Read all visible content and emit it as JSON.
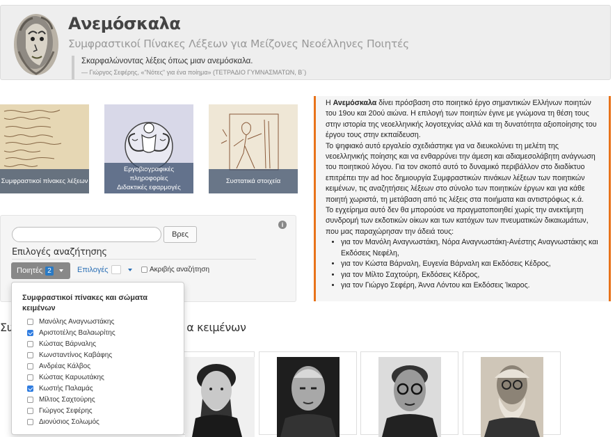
{
  "header": {
    "title": "Ανεμόσκαλα",
    "subtitle": "Συμφραστικοί Πίνακες Λέξεων για Μείζονες Νεοέλληνες Ποιητές",
    "quote_text": "Σκαρφαλώνοντας λέξεις όπως μιαν ανεμόσκαλα.",
    "quote_source": "— Γιώργος Σεφέρης, «\"Νότες\" για ένα ποίημα» (ΤΕΤΡΑΔΙΟ ΓΥΜΝΑΣΜΑΤΩΝ, Β΄)"
  },
  "tiles": [
    {
      "label": "Συμφραστικοί πίνακες λέξεων"
    },
    {
      "label_line1": "Εργοβιογραφικές",
      "label_line2": "πληροφορίες",
      "label_line3": "Διδακτικές εφαρμογές"
    },
    {
      "label": "Συστατικά στοιχεία"
    }
  ],
  "intro": {
    "p1_bold": "Ανεμόσκαλα",
    "p1_rest": " δίνει πρόσβαση στο ποιητικό έργο σημαντικών Ελλήνων ποιητών του 19ου και 20ού αιώνα. Η επιλογή των ποιητών έγινε με γνώμονα τη θέση τους στην ιστορία της νεοελληνικής λογοτεχνίας αλλά και τη δυνατότητα αξιοποίησης του έργου τους στην εκπαίδευση.",
    "p1_prefix": "Η ",
    "p2": "Το ψηφιακό αυτό εργαλείο σχεδιάστηκε για να διευκολύνει τη μελέτη της νεοελληνικής ποίησης και να ενθαρρύνει την άμεση και αδιαμεσολάβητη ανάγνωση του ποιητικού λόγου. Για τον σκοπό αυτό το δυναμικό περιβάλλον στο διαδίκτυο επιτρέπει την ad hoc δημιουργία Συμφραστικών πινάκων λέξεων των ποιητικών κειμένων, τις αναζητήσεις λέξεων στο σύνολο των ποιητικών έργων και για κάθε ποιητή χωριστά, τη μετάβαση από τις λέξεις στα ποιήματα και αντιστρόφως κ.ά.",
    "p3": "Το εγχείρημα αυτό δεν θα μπορούσε να πραγματοποιηθεί χωρίς την ανεκτίμητη συνδρομή των εκδοτικών οίκων και των κατόχων των πνευματικών δικαιωμάτων, που μας παραχώρησαν την άδειά τους:",
    "permissions": [
      "για τον Μανόλη Αναγνωστάκη, Νόρα Αναγνωστάκη-Ανέστης Αναγνωστάκης και Εκδόσεις Νεφέλη,",
      "για τον Κώστα Βάρναλη, Ευγενία Βάρναλη και Εκδόσεις Κέδρος,",
      "για τον Μίλτο Σαχτούρη, Εκδόσεις Κέδρος,",
      "για τον Γιώργο Σεφέρη, Άννα Λόντου και Εκδόσεις Ίκαρος."
    ]
  },
  "search": {
    "input_value": "",
    "button_label": "Βρες",
    "info_icon": "i",
    "options_title": "Επιλογές αναζήτησης",
    "poets_label": "Ποιητές",
    "poets_count": "2",
    "options_label": "Επιλογές",
    "exact_label": "Ακριβής αναζήτηση"
  },
  "section": {
    "heading_visible_start": "Συ",
    "heading_visible_end": "α κειμένων"
  },
  "dropdown": {
    "header": "Συμφραστικοί πίνακες και σώματα κειμένων",
    "items": [
      {
        "label": "Μανόλης Αναγνωστάκης",
        "checked": false
      },
      {
        "label": "Αριστοτέλης Βαλαωρίτης",
        "checked": true
      },
      {
        "label": "Κώστας Βάρναλης",
        "checked": false
      },
      {
        "label": "Κωνσταντίνος Καβάφης",
        "checked": false
      },
      {
        "label": "Ανδρέας Κάλβος",
        "checked": false
      },
      {
        "label": "Κώστας Καρυωτάκης",
        "checked": false
      },
      {
        "label": "Κωστής Παλαμάς",
        "checked": true
      },
      {
        "label": "Μίλτος Σαχτούρης",
        "checked": false
      },
      {
        "label": "Γιώργος Σεφέρης",
        "checked": false
      },
      {
        "label": "Διονύσιος Σολωμός",
        "checked": false
      }
    ]
  },
  "colors": {
    "accent_orange": "#e8731a",
    "link_blue": "#2a6fb5",
    "badge_blue": "#2a7ac4",
    "checkbox_blue": "#2f7ce0"
  }
}
